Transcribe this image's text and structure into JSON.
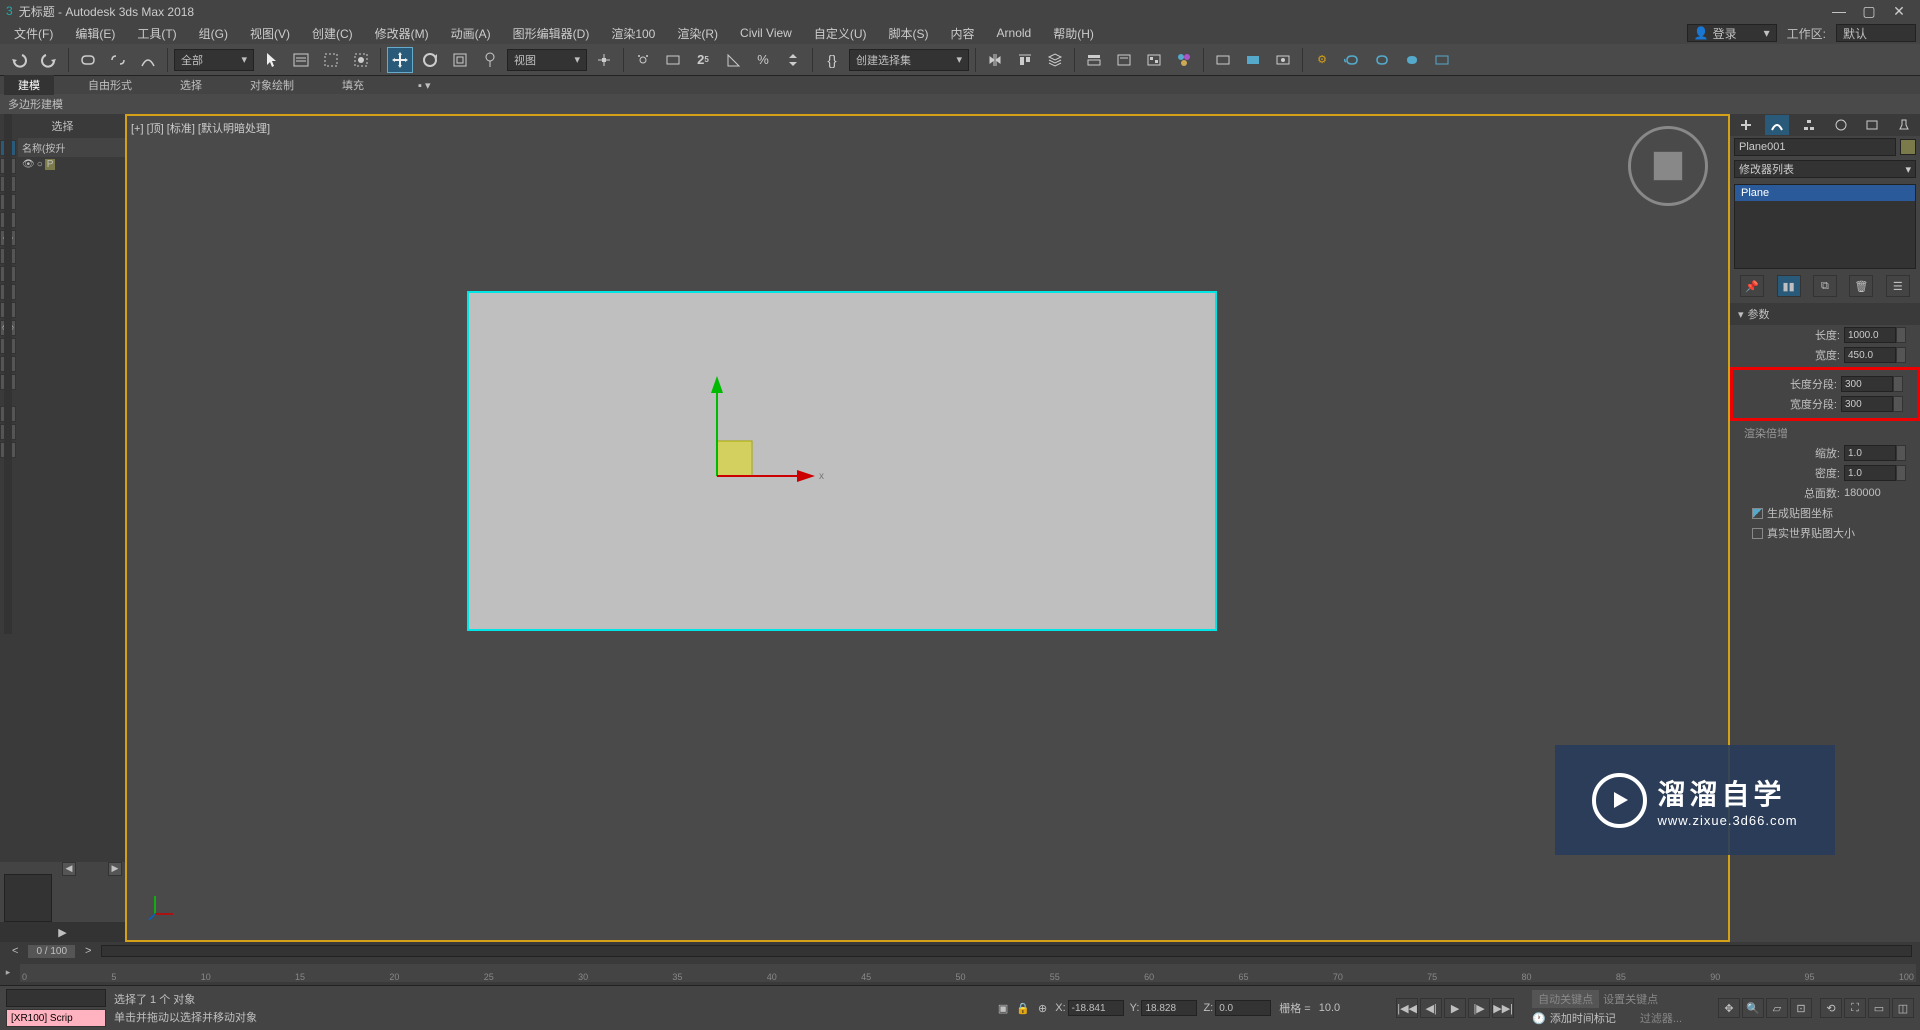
{
  "title": "无标题 - Autodesk 3ds Max 2018",
  "menu": {
    "file": "文件(F)",
    "edit": "编辑(E)",
    "tools": "工具(T)",
    "group": "组(G)",
    "views": "视图(V)",
    "create": "创建(C)",
    "modifiers": "修改器(M)",
    "animation": "动画(A)",
    "grapheditors": "图形编辑器(D)",
    "render100": "渲染100",
    "render": "渲染(R)",
    "civil": "Civil View",
    "custom": "自定义(U)",
    "script": "脚本(S)",
    "content": "内容",
    "arnold": "Arnold",
    "help": "帮助(H)"
  },
  "login": {
    "label": "登录",
    "ws_label": "工作区:",
    "ws_value": "默认"
  },
  "toolbar": {
    "all": "全部",
    "view": "视图",
    "csc": "创建选择集"
  },
  "ribbon": {
    "model": "建模",
    "freeform": "自由形式",
    "select": "选择",
    "objpaint": "对象绘制",
    "fill": "填充"
  },
  "subribbon": "多边形建模",
  "left": {
    "select": "选择",
    "namecol": "名称(按升",
    "obj": "P"
  },
  "viewport": {
    "label": "[+] [顶] [标准] [默认明暗处理]",
    "axis_x": "x"
  },
  "right": {
    "objname": "Plane001",
    "modlist_label": "修改器列表",
    "moditem": "Plane",
    "params_hdr": "参数",
    "len_label": "长度:",
    "len_val": "1000.0",
    "wid_label": "宽度:",
    "wid_val": "450.0",
    "lseg_label": "长度分段:",
    "lseg_val": "300",
    "wseg_label": "宽度分段:",
    "wseg_val": "300",
    "rmul_hdr": "渲染倍增",
    "scale_label": "缩放:",
    "scale_val": "1.0",
    "dens_label": "密度:",
    "dens_val": "1.0",
    "total_label": "总面数:",
    "total_val": "180000",
    "gen_map": "生成贴图坐标",
    "real_map": "真实世界贴图大小"
  },
  "time": {
    "pos": "0 / 100",
    "ticks": [
      "0",
      "5",
      "10",
      "15",
      "20",
      "25",
      "30",
      "35",
      "40",
      "45",
      "50",
      "55",
      "60",
      "65",
      "70",
      "75",
      "80",
      "85",
      "90",
      "95",
      "100"
    ]
  },
  "status": {
    "sel": "选择了 1 个 对象",
    "hint": "单击并拖动以选择并移动对象",
    "script": "[XR100] Scrip",
    "x": "-18.841",
    "y": "18.828",
    "z": "0.0",
    "grid_label": "栅格 =",
    "grid_val": "10.0",
    "addmark": "添加时间标记",
    "setkey": "设置关键点",
    "filt": "过滤器..."
  },
  "watermark": {
    "text": "溜溜自学",
    "url": "www.zixue.3d66.com"
  }
}
